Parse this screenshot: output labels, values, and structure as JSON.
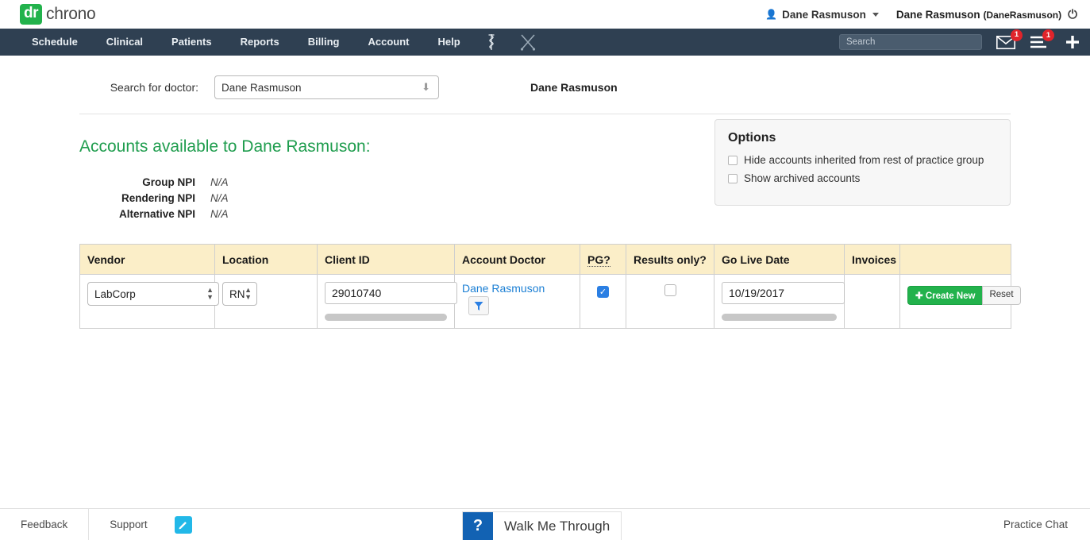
{
  "brand": {
    "logo_badge": "dr",
    "logo_text": "chrono",
    "green": "#22b24c",
    "nav_bg": "#2f4052"
  },
  "topbar": {
    "user_menu_label": "Dane Rasmuson",
    "user_icon": "person-icon",
    "account_name": "Dane Rasmuson",
    "account_username": "(DaneRasmuson)",
    "power_icon": "power-icon"
  },
  "nav": {
    "items": [
      {
        "label": "Schedule"
      },
      {
        "label": "Clinical"
      },
      {
        "label": "Patients"
      },
      {
        "label": "Reports"
      },
      {
        "label": "Billing"
      },
      {
        "label": "Account"
      },
      {
        "label": "Help"
      }
    ],
    "icons": [
      {
        "name": "asclepius-rod-icon"
      },
      {
        "name": "crossed-scalpels-icon"
      }
    ],
    "search_placeholder": "Search",
    "search_value": "",
    "messages_badge": "1",
    "tasks_badge": "1",
    "plus_icon": "plus-icon"
  },
  "doctor_search": {
    "label": "Search for doctor:",
    "selected": "Dane Rasmuson",
    "display_name": "Dane Rasmuson"
  },
  "accounts": {
    "title": "Accounts available to Dane Rasmuson:",
    "npi": [
      {
        "label": "Group NPI",
        "value": "N/A"
      },
      {
        "label": "Rendering NPI",
        "value": "N/A"
      },
      {
        "label": "Alternative NPI",
        "value": "N/A"
      }
    ]
  },
  "options": {
    "title": "Options",
    "items": [
      {
        "label": "Hide accounts inherited from rest of practice group",
        "checked": false
      },
      {
        "label": "Show archived accounts",
        "checked": false
      }
    ]
  },
  "table": {
    "headers": [
      "Vendor",
      "Location",
      "Client ID",
      "Account Doctor",
      "PG?",
      "Results only?",
      "Go Live Date",
      "Invoices",
      ""
    ],
    "rows": [
      {
        "vendor": "LabCorp",
        "location": "RN",
        "client_id": "29010740",
        "account_doctor": "Dane Rasmuson",
        "filter_icon": "funnel-icon",
        "pg_checked": true,
        "results_only_checked": false,
        "go_live_date": "10/19/2017",
        "invoices": "",
        "create_button": "Create New",
        "reset_button": "Reset"
      }
    ]
  },
  "footer": {
    "feedback": "Feedback",
    "support": "Support",
    "pencil_icon": "pencil-icon",
    "walk_me_through_q": "?",
    "walk_me_through": "Walk Me Through",
    "practice_chat": "Practice Chat"
  }
}
